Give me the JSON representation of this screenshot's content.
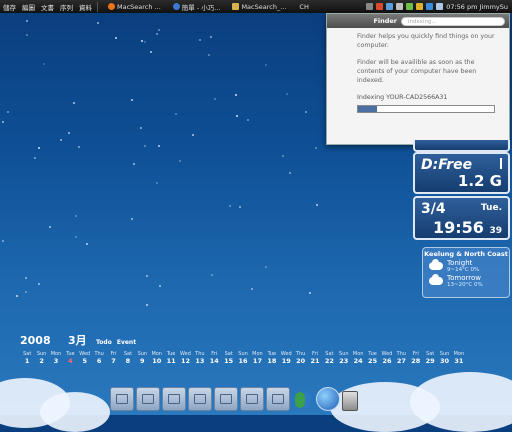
{
  "menubar": {
    "menus": [
      "儲存",
      "編圖",
      "文書",
      "序列",
      "資料"
    ],
    "tabs": [
      {
        "label": "MacSearch ...",
        "icon": "firefox-icon",
        "color": "#e8731c"
      },
      {
        "label": "簡單 - 小巧...",
        "icon": "browser-icon",
        "color": "#3a7ad6"
      },
      {
        "label": "MacSearch_...",
        "icon": "folder-icon",
        "color": "#d6b04c"
      }
    ],
    "ime": "CH",
    "clock": "07:56 pm JimmySu"
  },
  "finder": {
    "title": "Finder",
    "search_placeholder": "indexing...",
    "text1": "Finder helps you quickly find things on your computer.",
    "text2": "Finder will be availible as soon as the contents of your computer have been indexed.",
    "indexing_label": "Indexing YOUR-CAD2566A31",
    "progress": 0.14
  },
  "widgets": {
    "disk_label": "D:Free",
    "disk_value": "1.2 G",
    "date": "3/4",
    "weekday": "Tue.",
    "time": "19:56",
    "seconds": "39",
    "weather_location": "Keelung & North Coast",
    "tonight_label": "Tonight",
    "tonight_temp": "9~14°C 0%",
    "tomorrow_label": "Tomorrow",
    "tomorrow_temp": "13~20°C 0%"
  },
  "calendar": {
    "year": "2008",
    "month": "3月",
    "todo": "Todo",
    "event": "Event",
    "today": 4,
    "days": [
      {
        "n": "Sat",
        "d": "1"
      },
      {
        "n": "Sun",
        "d": "2"
      },
      {
        "n": "Mon",
        "d": "3"
      },
      {
        "n": "Tue",
        "d": "4"
      },
      {
        "n": "Wed",
        "d": "5"
      },
      {
        "n": "Thu",
        "d": "6"
      },
      {
        "n": "Fri",
        "d": "7"
      },
      {
        "n": "Sat",
        "d": "8"
      },
      {
        "n": "Sun",
        "d": "9"
      },
      {
        "n": "Mon",
        "d": "10"
      },
      {
        "n": "Tue",
        "d": "11"
      },
      {
        "n": "Wed",
        "d": "12"
      },
      {
        "n": "Thu",
        "d": "13"
      },
      {
        "n": "Fri",
        "d": "14"
      },
      {
        "n": "Sat",
        "d": "15"
      },
      {
        "n": "Sun",
        "d": "16"
      },
      {
        "n": "Mon",
        "d": "17"
      },
      {
        "n": "Tue",
        "d": "18"
      },
      {
        "n": "Wed",
        "d": "19"
      },
      {
        "n": "Thu",
        "d": "20"
      },
      {
        "n": "Fri",
        "d": "21"
      },
      {
        "n": "Sat",
        "d": "22"
      },
      {
        "n": "Sun",
        "d": "23"
      },
      {
        "n": "Mon",
        "d": "24"
      },
      {
        "n": "Tue",
        "d": "25"
      },
      {
        "n": "Wed",
        "d": "26"
      },
      {
        "n": "Thu",
        "d": "27"
      },
      {
        "n": "Fri",
        "d": "28"
      },
      {
        "n": "Sat",
        "d": "29"
      },
      {
        "n": "Sun",
        "d": "30"
      },
      {
        "n": "Mon",
        "d": "31"
      }
    ]
  },
  "dock": {
    "items": [
      "home-folder-icon",
      "music-folder-icon",
      "movies-folder-icon",
      "applications-folder-icon",
      "documents-folder-icon",
      "desktop-folder-icon",
      "downloads-folder-icon",
      "msn-messenger-icon",
      "internet-globe-icon",
      "trash-icon"
    ]
  }
}
